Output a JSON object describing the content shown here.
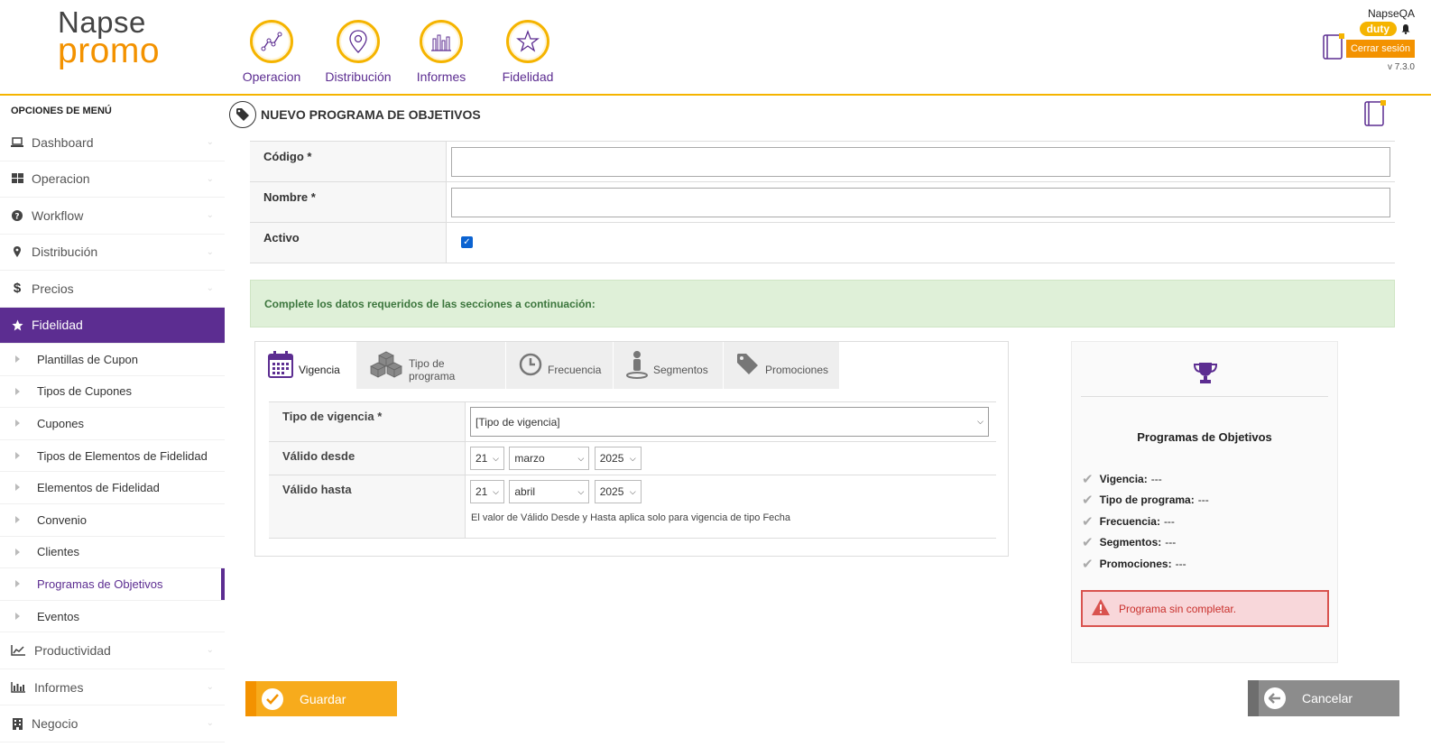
{
  "logo": {
    "line1": "Napse",
    "line2": "promo"
  },
  "topnav": [
    {
      "label": "Operacion",
      "icon": "graph-icon"
    },
    {
      "label": "Distribución",
      "icon": "map-pin-icon"
    },
    {
      "label": "Informes",
      "icon": "bar-chart-icon"
    },
    {
      "label": "Fidelidad",
      "icon": "star-icon"
    }
  ],
  "header": {
    "user": "NapseQA",
    "badge": "duty",
    "logout": "Cerrar sesión",
    "version": "v 7.3.0"
  },
  "sidebar": {
    "title": "OPCIONES DE MENÚ",
    "items": [
      {
        "label": "Dashboard",
        "icon": "laptop-icon"
      },
      {
        "label": "Operacion",
        "icon": "grid-icon"
      },
      {
        "label": "Workflow",
        "icon": "question-icon"
      },
      {
        "label": "Distribución",
        "icon": "map-pin-icon"
      },
      {
        "label": "Precios",
        "icon": "dollar-icon"
      },
      {
        "label": "Fidelidad",
        "icon": "star-icon",
        "active": true
      }
    ],
    "subitems": [
      "Plantillas de Cupon",
      "Tipos de Cupones",
      "Cupones",
      "Tipos de Elementos de Fidelidad",
      "Elementos de Fidelidad",
      "Convenio",
      "Clientes",
      "Programas de Objetivos",
      "Eventos"
    ],
    "current_sub": "Programas de Objetivos",
    "bottom_items": [
      {
        "label": "Productividad",
        "icon": "line-chart-icon"
      },
      {
        "label": "Informes",
        "icon": "bar-chart-icon"
      },
      {
        "label": "Negocio",
        "icon": "building-icon"
      }
    ]
  },
  "page": {
    "title": "NUEVO PROGRAMA DE OBJETIVOS"
  },
  "form": {
    "codigo_label": "Código *",
    "codigo_value": "",
    "nombre_label": "Nombre *",
    "nombre_value": "",
    "activo_label": "Activo",
    "activo_checked": true
  },
  "notice": "Complete los datos requeridos de las secciones a continuación:",
  "tabs": [
    {
      "label": "Vigencia",
      "icon": "calendar-icon",
      "active": true
    },
    {
      "label": "Tipo de programa",
      "icon": "boxes-icon"
    },
    {
      "label": "Frecuencia",
      "icon": "clock-icon"
    },
    {
      "label": "Segmentos",
      "icon": "person-icon"
    },
    {
      "label": "Promociones",
      "icon": "tag-icon"
    }
  ],
  "vigencia": {
    "tipo_label": "Tipo de vigencia *",
    "tipo_value": "[Tipo de vigencia]",
    "desde_label": "Válido desde",
    "desde": {
      "day": "21",
      "month": "marzo",
      "year": "2025"
    },
    "hasta_label": "Válido hasta",
    "hasta": {
      "day": "21",
      "month": "abril",
      "year": "2025"
    },
    "hint": "El valor de Válido Desde y Hasta aplica solo para vigencia de tipo Fecha"
  },
  "summary": {
    "title": "Programas de Objetivos",
    "items": [
      {
        "label": "Vigencia:",
        "value": "---"
      },
      {
        "label": "Tipo de programa:",
        "value": "---"
      },
      {
        "label": "Frecuencia:",
        "value": "---"
      },
      {
        "label": "Segmentos:",
        "value": "---"
      },
      {
        "label": "Promociones:",
        "value": "---"
      }
    ],
    "alert": "Programa sin completar."
  },
  "buttons": {
    "save": "Guardar",
    "cancel": "Cancelar"
  },
  "colors": {
    "accent": "#f5b400",
    "brand_purple": "#5c2d91",
    "orange": "#f39200",
    "success_bg": "#dff0d8",
    "danger": "#d9534f"
  }
}
